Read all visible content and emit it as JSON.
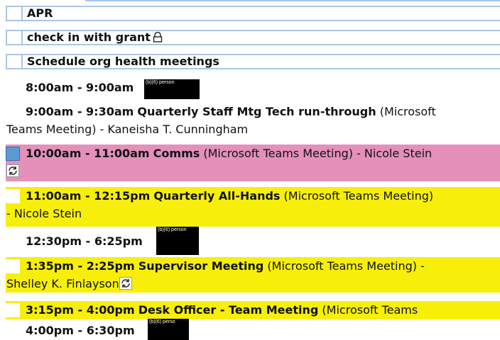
{
  "tasks": [
    {
      "label": "APR",
      "locked": false
    },
    {
      "label": "check in with grant",
      "locked": true
    },
    {
      "label": "Schedule org health meetings",
      "locked": false
    }
  ],
  "appointments": [
    {
      "time": "8:00am - 9:00am",
      "subject": "",
      "detail": "",
      "redaction": "(b)(6) person"
    },
    {
      "time": "9:00am - 9:30am",
      "subject": "Quarterly Staff Mtg Tech run-through",
      "detail": "(Microsoft",
      "detail2": "Teams Meeting) - Kaneisha T. Cunningham"
    },
    {
      "time": "10:00am - 11:00am",
      "subject": "Comms",
      "detail": "(Microsoft Teams Meeting) - Nicole Stein"
    },
    {
      "time": "11:00am - 12:15pm",
      "subject": "Quarterly All-Hands",
      "detail": "(Microsoft Teams Meeting)",
      "detail2": "- Nicole Stein"
    },
    {
      "time": "12:30pm - 6:25pm",
      "subject": "",
      "detail": "",
      "redaction": "(b)(6) person"
    },
    {
      "time": "1:35pm - 2:25pm",
      "subject": "Supervisor Meeting",
      "detail": "(Microsoft Teams Meeting) -",
      "detail2": "Shelley K. Finlayson"
    },
    {
      "time": "3:15pm - 4:00pm",
      "subject": "Desk Officer - Team Meeting",
      "detail": " (Microsoft Teams"
    },
    {
      "time": "4:00pm - 6:30pm",
      "subject": "",
      "detail": "",
      "redaction": "(b)(6) perso"
    }
  ],
  "colors": {
    "yellow": "#f7ef0a",
    "pink": "#e490ba",
    "task_border": "#a9c6e8",
    "checkbox_blue": "#5b9bd5"
  }
}
